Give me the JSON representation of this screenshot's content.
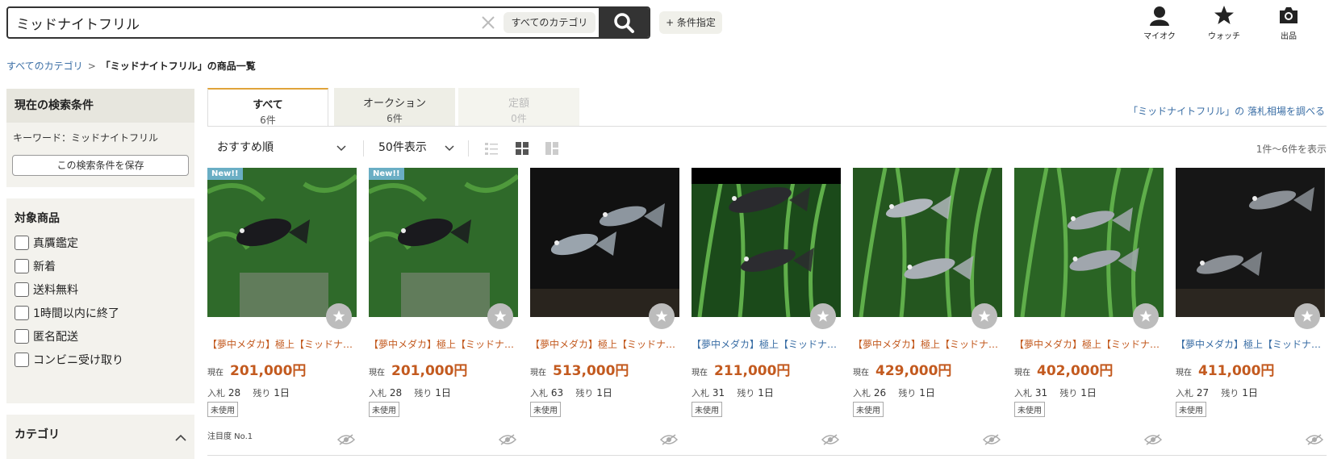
{
  "search": {
    "value": "ミッドナイトフリル",
    "category": "すべてのカテゴリ",
    "condition_button": "+ 条件指定"
  },
  "header_icons": [
    {
      "label": "マイオク",
      "icon": "user-icon"
    },
    {
      "label": "ウォッチ",
      "icon": "star-icon"
    },
    {
      "label": "出品",
      "icon": "camera-icon"
    }
  ],
  "breadcrumb": {
    "root": "すべてのカテゴリ",
    "separator": ">",
    "current": "「ミッドナイトフリル」の商品一覧"
  },
  "sidebar": {
    "current_title": "現在の検索条件",
    "keyword": "キーワード：ミッドナイトフリル",
    "save_label": "この検索条件を保存",
    "filter_title": "対象商品",
    "filters": [
      "真贋鑑定",
      "新着",
      "送料無料",
      "1時間以内に終了",
      "匿名配送",
      "コンビニ受け取り"
    ],
    "category_title": "カテゴリ"
  },
  "tabs": [
    {
      "label": "すべて",
      "count": "6件"
    },
    {
      "label": "オークション",
      "count": "6件"
    },
    {
      "label": "定額",
      "count": "0件"
    }
  ],
  "market_link": "「ミッドナイトフリル」の 落札相場を調べる",
  "sort": {
    "order": "おすすめ順",
    "per_page": "50件表示",
    "count_text": "1件〜6件を表示"
  },
  "colors": {
    "price": "#c35a1f",
    "link": "#3a6ea5",
    "accent": "#e0a33a",
    "new_badge": "#6aaec4"
  },
  "products": [
    {
      "title": "【夢中メダカ】極上【ミッドナイトフリル】",
      "title_color": "orange",
      "price_label": "現在",
      "price": "201,000円",
      "bids_label": "入札",
      "bids": "28",
      "remain_label": "残り",
      "remain": "1日",
      "condition": "未使用",
      "badge": "New!!",
      "attention": "注目度 No.1"
    },
    {
      "title": "【夢中メダカ】極上【ミッドナイトフリル】",
      "title_color": "orange",
      "price_label": "現在",
      "price": "201,000円",
      "bids_label": "入札",
      "bids": "28",
      "remain_label": "残り",
      "remain": "1日",
      "condition": "未使用",
      "badge": "New!!"
    },
    {
      "title": "【夢中メダカ】極上【ミッドナイトフリル】",
      "title_color": "orange",
      "price_label": "現在",
      "price": "513,000円",
      "bids_label": "入札",
      "bids": "63",
      "remain_label": "残り",
      "remain": "1日",
      "condition": "未使用"
    },
    {
      "title": "【夢中メダカ】極上【ミッドナイトフリル】",
      "title_color": "blue",
      "price_label": "現在",
      "price": "211,000円",
      "bids_label": "入札",
      "bids": "31",
      "remain_label": "残り",
      "remain": "1日",
      "condition": "未使用"
    },
    {
      "title": "【夢中メダカ】極上【ミッドナイトフリル】",
      "title_color": "orange",
      "price_label": "現在",
      "price": "429,000円",
      "bids_label": "入札",
      "bids": "26",
      "remain_label": "残り",
      "remain": "1日",
      "condition": "未使用"
    },
    {
      "title": "【夢中メダカ】極上【ミッドナイトフリル】",
      "title_color": "orange",
      "price_label": "現在",
      "price": "402,000円",
      "bids_label": "入札",
      "bids": "31",
      "remain_label": "残り",
      "remain": "1日",
      "condition": "未使用"
    },
    {
      "title": "【夢中メダカ】極上【ミッドナイトフリル】",
      "title_color": "blue",
      "price_label": "現在",
      "price": "411,000円",
      "bids_label": "入札",
      "bids": "27",
      "remain_label": "残り",
      "remain": "1日",
      "condition": "未使用"
    }
  ]
}
